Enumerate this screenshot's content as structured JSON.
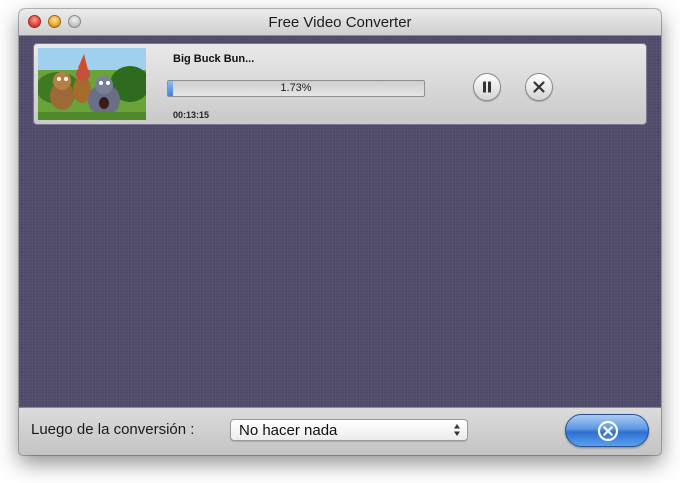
{
  "window": {
    "title": "Free Video Converter"
  },
  "job": {
    "name": "Big Buck Bun...",
    "progress_fraction": 0.0173,
    "progress_text": "1.73%",
    "elapsed": "00:13:15",
    "pause_icon": "pause-icon",
    "stop_icon": "close-icon"
  },
  "footer": {
    "after_label": "Luego de la conversión :",
    "after_value": "No hacer nada",
    "action_icon": "cancel-circle-icon"
  },
  "colors": {
    "content_bg": "#4f4b6a",
    "progress_fill": "#3d82d8",
    "action_button": "#3b7ad8"
  }
}
